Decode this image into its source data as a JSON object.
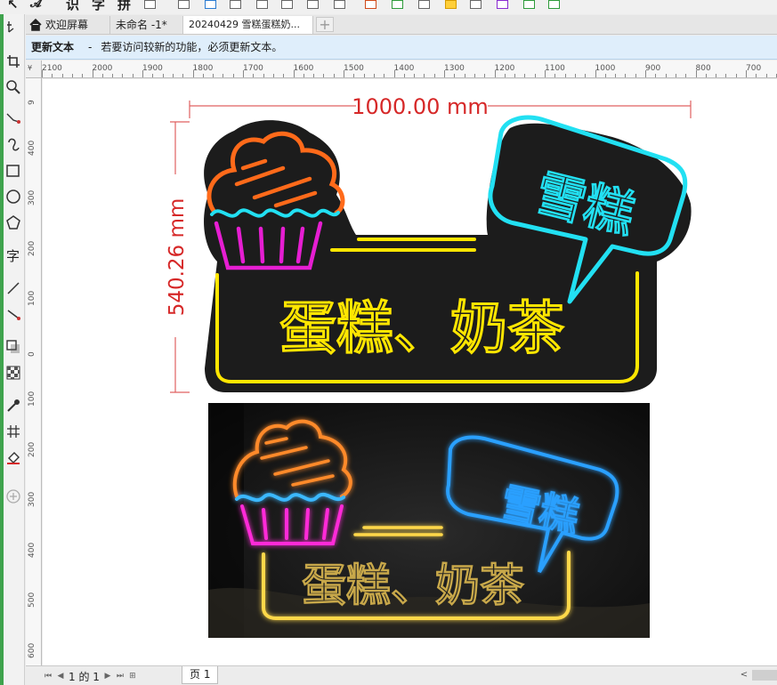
{
  "toolbar": {
    "labels": [
      "识",
      "字",
      "拼"
    ],
    "icons": [
      "pointer-icon",
      "text-style-icon",
      "layout-icon",
      "grid-icon",
      "snap-icon",
      "align-icon",
      "color-icon",
      "spray-icon",
      "app-icon"
    ]
  },
  "tabs": {
    "welcome": "欢迎屏幕",
    "untitled": "未命名 -1*",
    "document": "20240429 雪糕蛋糕奶...",
    "add": "+"
  },
  "infobar": {
    "title": "更新文本",
    "separator": "-",
    "message": "若要访问较新的功能，必须更新文本。"
  },
  "ruler": {
    "corner": "¥",
    "horizontal": [
      "2100",
      "2000",
      "1900",
      "1800",
      "1700",
      "1600",
      "1500",
      "1400",
      "1300",
      "1200",
      "1100",
      "1000",
      "900",
      "800",
      "700"
    ],
    "vertical": [
      "9",
      "400",
      "300",
      "200",
      "100",
      "0",
      "100",
      "200",
      "300",
      "400",
      "500",
      "600"
    ]
  },
  "design": {
    "width_label": "1000.00 mm",
    "height_label": "540.26 mm",
    "main_text": "蛋糕、奶茶",
    "bubble_text": "雪糕",
    "colors": {
      "dimension": "#d62828",
      "panel": "#1c1c1c",
      "yellow": "#ffe600",
      "cyan": "#22e0f2",
      "orange": "#ff6a1a",
      "magenta": "#e61ed2"
    }
  },
  "photo": {
    "main_text": "蛋糕、奶茶",
    "bubble_text": "雪糕"
  },
  "status": {
    "page_of": "1 的 1",
    "page_tab": "页 1",
    "scroll_left": "<"
  }
}
